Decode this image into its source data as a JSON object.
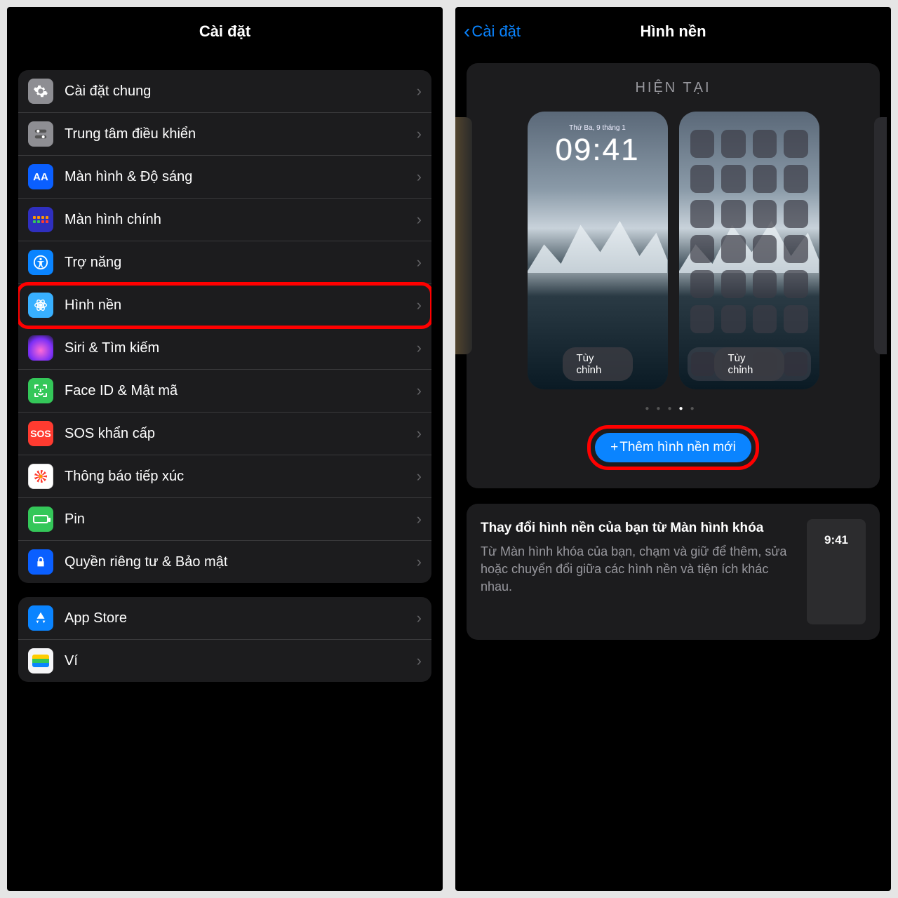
{
  "left": {
    "title": "Cài đặt",
    "groups": [
      {
        "items": [
          {
            "icon": "general",
            "label": "Cài đặt chung"
          },
          {
            "icon": "control",
            "label": "Trung tâm điều khiển"
          },
          {
            "icon": "display",
            "label": "Màn hình & Độ sáng",
            "iconText": "AA"
          },
          {
            "icon": "home",
            "label": "Màn hình chính"
          },
          {
            "icon": "access",
            "label": "Trợ năng"
          },
          {
            "icon": "wallpaper",
            "label": "Hình nền",
            "highlight": true
          },
          {
            "icon": "siri",
            "label": "Siri & Tìm kiếm"
          },
          {
            "icon": "faceid",
            "label": "Face ID & Mật mã"
          },
          {
            "icon": "sos",
            "label": "SOS khẩn cấp",
            "iconText": "SOS"
          },
          {
            "icon": "exposure",
            "label": "Thông báo tiếp xúc"
          },
          {
            "icon": "battery",
            "label": "Pin"
          },
          {
            "icon": "privacy",
            "label": "Quyền riêng tư & Bảo mật"
          }
        ]
      },
      {
        "items": [
          {
            "icon": "appstore",
            "label": "App Store"
          },
          {
            "icon": "wallet",
            "label": "Ví"
          }
        ]
      }
    ]
  },
  "right": {
    "back": "Cài đặt",
    "title": "Hình nền",
    "panel_header": "HIỆN TẠI",
    "lock_date": "Thứ Ba, 9 tháng 1",
    "lock_time": "09:41",
    "customize": "Tùy chỉnh",
    "page_dots": 5,
    "page_active": 3,
    "add_label": "Thêm hình nền mới",
    "info": {
      "title": "Thay đổi hình nền của bạn từ Màn hình khóa",
      "body": "Từ Màn hình khóa của bạn, chạm và giữ để thêm, sửa hoặc chuyển đổi giữa các hình nền và tiện ích khác nhau.",
      "thumb": "9:41"
    }
  }
}
